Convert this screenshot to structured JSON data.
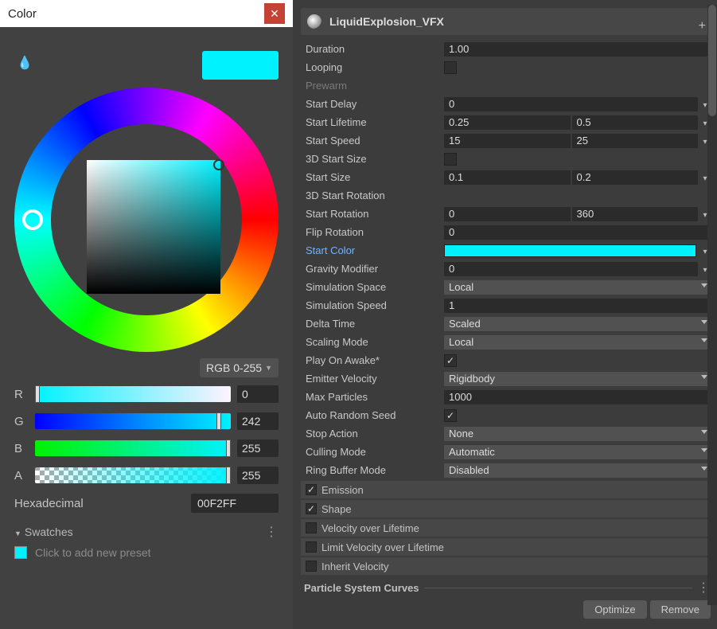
{
  "color_picker": {
    "title": "Color",
    "mode": "RGB 0-255",
    "channels": {
      "r": {
        "label": "R",
        "value": "0",
        "thumb_pct": 0
      },
      "g": {
        "label": "G",
        "value": "242",
        "thumb_pct": 95
      },
      "b": {
        "label": "B",
        "value": "255",
        "thumb_pct": 100
      },
      "a": {
        "label": "A",
        "value": "255",
        "thumb_pct": 100
      }
    },
    "hex_label": "Hexadecimal",
    "hex_value": "00F2FF",
    "preview_color": "#00f2ff",
    "swatches_label": "Swatches",
    "swatches_hint": "Click to add new preset"
  },
  "inspector": {
    "header": "LiquidExplosion_VFX",
    "props": {
      "duration": {
        "label": "Duration",
        "type": "num",
        "a": "1.00"
      },
      "looping": {
        "label": "Looping",
        "type": "chk",
        "checked": false
      },
      "prewarm": {
        "label": "Prewarm",
        "type": "blank",
        "dim": true
      },
      "start_delay": {
        "label": "Start Delay",
        "type": "num1d",
        "a": "0"
      },
      "start_lifetime": {
        "label": "Start Lifetime",
        "type": "num2d",
        "a": "0.25",
        "b": "0.5"
      },
      "start_speed": {
        "label": "Start Speed",
        "type": "num2d",
        "a": "15",
        "b": "25"
      },
      "3d_start_size": {
        "label": "3D Start Size",
        "type": "chk",
        "checked": false
      },
      "start_size": {
        "label": "Start Size",
        "type": "num2d",
        "a": "0.1",
        "b": "0.2"
      },
      "3d_start_rot": {
        "label": "3D Start Rotation",
        "type": "blank"
      },
      "start_rotation": {
        "label": "Start Rotation",
        "type": "num2d",
        "a": "0",
        "b": "360"
      },
      "flip_rotation": {
        "label": "Flip Rotation",
        "type": "num",
        "a": "0"
      },
      "start_color": {
        "label": "Start Color",
        "type": "colord",
        "color": "#00f2ff",
        "selected": true
      },
      "gravity": {
        "label": "Gravity Modifier",
        "type": "num1d",
        "a": "0"
      },
      "sim_space": {
        "label": "Simulation Space",
        "type": "drop",
        "a": "Local"
      },
      "sim_speed": {
        "label": "Simulation Speed",
        "type": "num",
        "a": "1"
      },
      "delta_time": {
        "label": "Delta Time",
        "type": "drop",
        "a": "Scaled"
      },
      "scaling_mode": {
        "label": "Scaling Mode",
        "type": "drop",
        "a": "Local"
      },
      "play_on_awake": {
        "label": "Play On Awake*",
        "type": "chk",
        "checked": true
      },
      "emitter_vel": {
        "label": "Emitter Velocity",
        "type": "drop",
        "a": "Rigidbody"
      },
      "max_particles": {
        "label": "Max Particles",
        "type": "num",
        "a": "1000"
      },
      "auto_seed": {
        "label": "Auto Random Seed",
        "type": "chk",
        "checked": true
      },
      "stop_action": {
        "label": "Stop Action",
        "type": "drop",
        "a": "None"
      },
      "culling_mode": {
        "label": "Culling Mode",
        "type": "drop",
        "a": "Automatic"
      },
      "ring_buffer": {
        "label": "Ring Buffer Mode",
        "type": "drop",
        "a": "Disabled"
      }
    },
    "modules": [
      {
        "label": "Emission",
        "checked": true
      },
      {
        "label": "Shape",
        "checked": true
      },
      {
        "label": "Velocity over Lifetime",
        "checked": false
      },
      {
        "label": "Limit Velocity over Lifetime",
        "checked": false
      },
      {
        "label": "Inherit Velocity",
        "checked": false
      }
    ],
    "curves_label": "Particle System Curves",
    "buttons": {
      "optimize": "Optimize",
      "remove": "Remove"
    }
  }
}
